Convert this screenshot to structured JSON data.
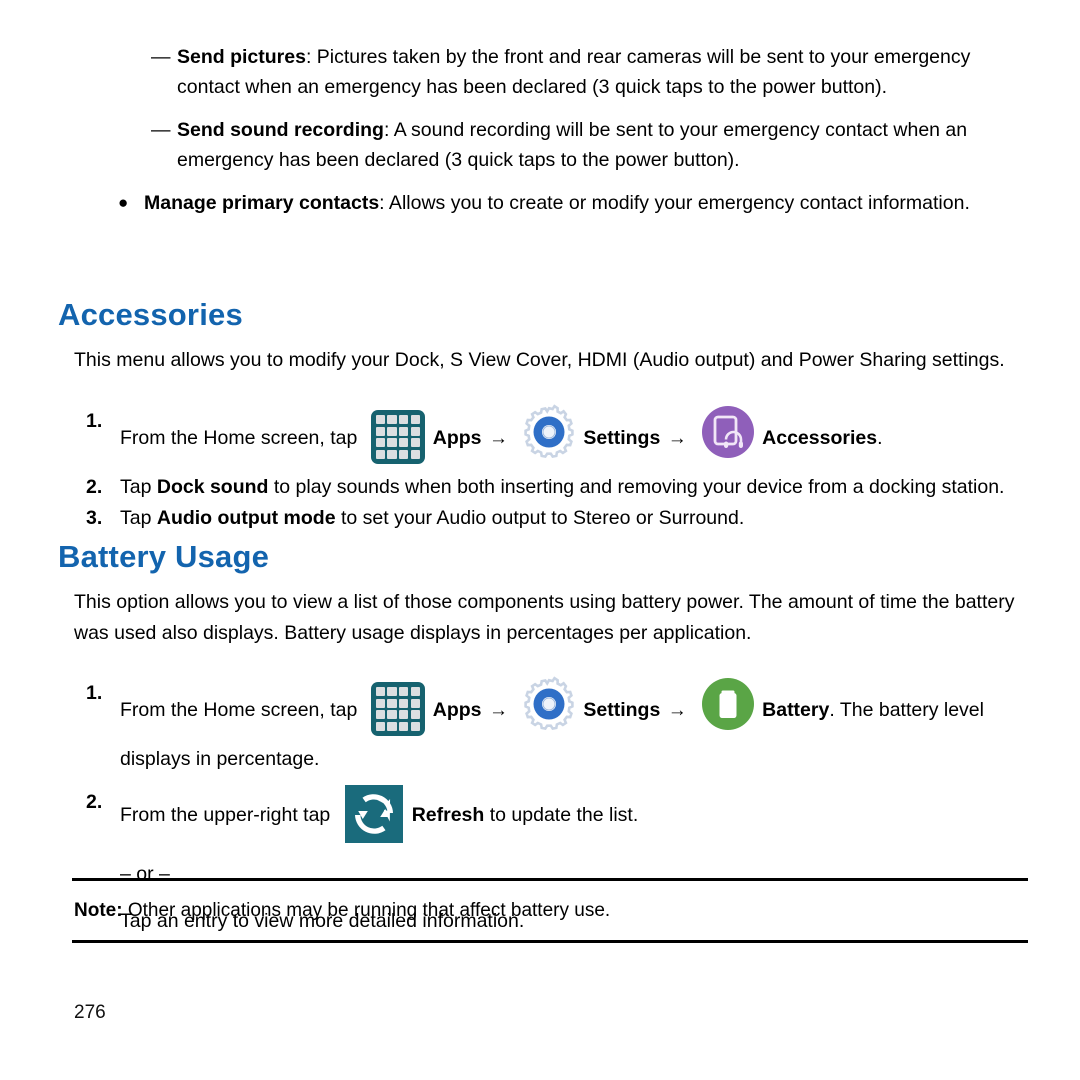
{
  "document": {
    "page_number": "276"
  },
  "bullets": [
    {
      "marker": "—",
      "type": "dash",
      "term": "Send pictures",
      "separator": ":",
      "text": " Pictures taken by the front and rear cameras will be sent to your emergency contact when an emergency has been declared (3 quick taps to the power button)."
    },
    {
      "marker": "—",
      "type": "dash",
      "term": "Send sound recording",
      "separator": ":",
      "text": " A sound recording will be sent to your emergency contact when an emergency has been declared (3 quick taps to the power button)."
    },
    {
      "marker": "●",
      "type": "dot",
      "term": "Manage primary contacts",
      "separator": ":",
      "text": " Allows you to create or modify your emergency contact information."
    }
  ],
  "accessories": {
    "heading": "Accessories",
    "intro": "This menu allows you to modify your Dock, S View Cover, HDMI (Audio output) and Power Sharing settings.",
    "steps": [
      {
        "num": "1.",
        "lead": "From the Home screen, tap ",
        "apps_label": "Apps",
        "arrow1": "→",
        "settings_label": "Settings",
        "arrow2": "→",
        "target_label": "Accessories",
        "tail": "."
      },
      {
        "num": "2.",
        "pre": "Tap ",
        "bold": "Dock sound",
        "post": " to play sounds when both inserting and removing your device from a docking station."
      },
      {
        "num": "3.",
        "pre": "Tap ",
        "bold": "Audio output mode",
        "post": " to set your Audio output to Stereo or Surround."
      }
    ]
  },
  "battery": {
    "heading": "Battery Usage",
    "intro": "This option allows you to view a list of those components using battery power. The amount of time the battery was used also displays. Battery usage displays in percentages per application.",
    "steps": [
      {
        "num": "1.",
        "lead": "From the Home screen, tap ",
        "apps_label": "Apps",
        "arrow1": "→",
        "settings_label": "Settings",
        "arrow2": "→",
        "target_label": "Battery",
        "tail": ". The battery level displays in percentage."
      },
      {
        "num": "2.",
        "lead": "From the upper-right tap ",
        "refresh_label": "Refresh",
        "tail": " to update the list."
      }
    ],
    "or_text": "– or –",
    "alt_text": "Tap an entry to view more detailed information."
  },
  "note": {
    "label": "Note:",
    "text": " Other applications may be running that affect battery use."
  },
  "colors": {
    "heading_blue": "#1364ae",
    "apps_teal": "#16626f",
    "gear_blue": "#2d6fc4",
    "accessories_purple": "#8f5fba",
    "battery_green": "#5aa546",
    "refresh_teal": "#1a6b7c"
  },
  "icons": {
    "apps": "apps-grid-icon",
    "settings": "gear-icon",
    "accessories": "accessories-icon",
    "battery": "battery-icon",
    "refresh": "refresh-icon"
  }
}
